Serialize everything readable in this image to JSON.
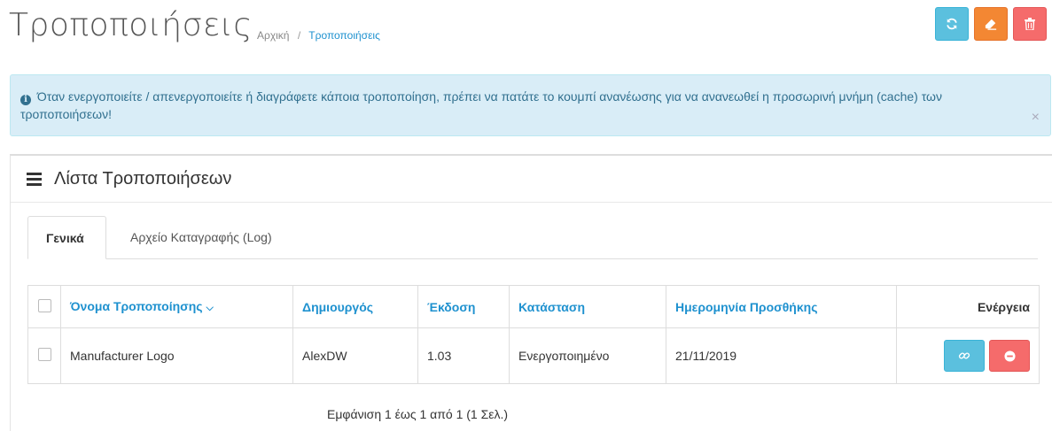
{
  "header": {
    "title": "Τροποποιήσεις",
    "breadcrumb": [
      "Αρχική",
      "Τροποποιήσεις"
    ],
    "breadcrumb_sep": "/"
  },
  "toolbar": {
    "refresh_icon": "refresh-icon",
    "clear_icon": "eraser-icon",
    "delete_icon": "trash-icon",
    "colors": {
      "info": "#5bc0de",
      "warning": "#f38733",
      "danger": "#f56b6b"
    }
  },
  "alert": {
    "icon": "info-circle-icon",
    "text": "Όταν ενεργοποιείτε / απενεργοποιείτε ή διαγράφετε κάποια τροποποίηση, πρέπει να πατάτε το κουμπί ανανέωσης για να ανανεωθεί η προσωρινή μνήμη (cache) των τροποποιήσεων!",
    "close": "×"
  },
  "panel": {
    "icon": "list-icon",
    "title": "Λίστα Τροποποιήσεων",
    "tabs": [
      {
        "label": "Γενικά",
        "active": true
      },
      {
        "label": "Αρχείο Καταγραφής (Log)",
        "active": false
      }
    ]
  },
  "table": {
    "headers": {
      "name": "Όνομα Τροποποίησης",
      "author": "Δημιουργός",
      "version": "Έκδοση",
      "status": "Κατάσταση",
      "date_added": "Ημερομηνία Προσθήκης",
      "action": "Ενέργεια"
    },
    "sort_icon": "chevron-down-icon",
    "rows": [
      {
        "name": "Manufacturer Logo",
        "author": "AlexDW",
        "version": "1.03",
        "status": "Ενεργοποιημένο",
        "date_added": "21/11/2019"
      }
    ]
  },
  "pagination": {
    "text": "Εμφάνιση 1 έως 1 από 1 (1 Σελ.)"
  }
}
